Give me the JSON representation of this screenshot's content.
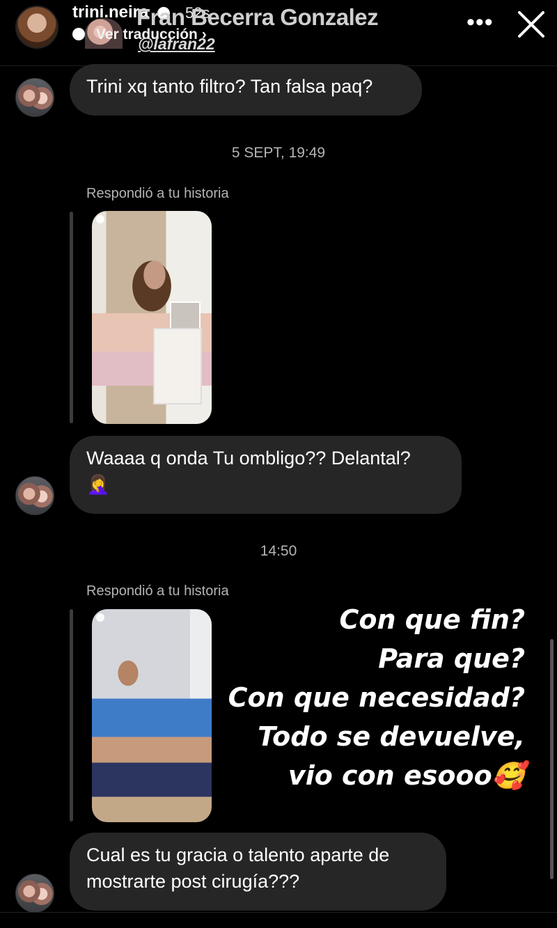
{
  "story": {
    "username": "trini.neira",
    "time_ago": "52s",
    "translate_label": "Ver traducción",
    "menu_icon": "more-horizontal-icon",
    "close_icon": "close-icon"
  },
  "chat": {
    "contact_name": "Fran Becerra Gonzalez",
    "contact_handle": "@lafran22",
    "messages": [
      {
        "type": "text",
        "text": "Trini xq tanto filtro? Tan falsa paq?"
      },
      {
        "type": "timestamp",
        "text": "5 SEPT, 19:49"
      },
      {
        "type": "story_reply",
        "label": "Respondió a tu historia"
      },
      {
        "type": "text",
        "text": "Waaaa q onda Tu ombligo?? Delantal?",
        "emoji": "🤦‍♀️"
      },
      {
        "type": "timestamp",
        "text": "14:50"
      },
      {
        "type": "story_reply",
        "label": "Respondió a tu historia"
      },
      {
        "type": "text",
        "text_line1": "Cual es tu gracia o talento aparte de",
        "text_line2": "mostrarte post cirugía???"
      }
    ]
  },
  "overlay": {
    "lines": [
      "Con que fin?",
      "Para que?",
      "Con que necesidad?",
      "Todo se devuelve,",
      "vio con esooo🥰"
    ]
  },
  "colors": {
    "background": "#000000",
    "bubble": "#262626",
    "meta_text": "#b4b4b4"
  }
}
